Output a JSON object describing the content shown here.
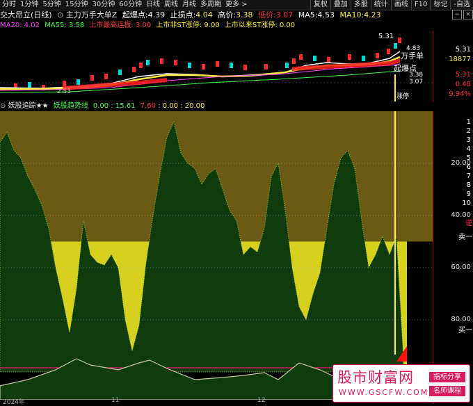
{
  "toolbar": {
    "periods": [
      "分时",
      "1分钟",
      "5分钟",
      "15分钟",
      "30分钟",
      "60分钟",
      "日线",
      "周线",
      "月线",
      "多周期",
      "更多 >"
    ],
    "right": [
      "复权",
      "叠加",
      "多股",
      "统计",
      "画线",
      "F10",
      "标记",
      "-自选"
    ]
  },
  "info1": {
    "stock": "交大昂立(日线)",
    "indicator": "主力万手大单Z",
    "stop_label": "起爆点:",
    "stop_val": "4.39",
    "sl_label": "止损点:",
    "sl_val": "4.04",
    "high_label": "高价:",
    "high_val": "3.38",
    "low_label": "低价:",
    "low_val": "3.07",
    "ma5_label": "MA5:",
    "ma5_val": "4.53",
    "ma10_label": "MA10:",
    "ma10_val": "4.23"
  },
  "info2": {
    "ma20": "MA20: 4.02",
    "ma55": "MA55: 3.58",
    "t1": "上市最高连板: 3.00",
    "t2": "上市非ST涨停: 9.00",
    "t3": "上市以来ST涨停: 0.00"
  },
  "main_annotations": {
    "price_top": "5.31",
    "wansh": "万手单",
    "qibao": "起爆点",
    "p1": "4.83",
    "p2": "3.38",
    "p3": "3.07",
    "left": "2.53",
    "zhangting": "涨停"
  },
  "right_axis": {
    "top": [
      "5.31",
      "18877",
      "5.31",
      "0.48",
      "9.94%"
    ],
    "mid": "527",
    "nums": [
      "1",
      "2",
      "3",
      "4",
      "5",
      "6",
      "7",
      "8",
      "9",
      "10"
    ],
    "labels": {
      "ticks": [
        "80.00",
        "60.00",
        "40.00",
        "20.00"
      ],
      "sell": "卖一",
      "buy": "买一",
      "ni": "逆"
    }
  },
  "ind_header": {
    "name": "妖股追踪★★",
    "line": "妖股趋势线",
    "v1": "0.00",
    "v2": "15.61",
    "v3": "7.60",
    "v4": "0.00",
    "v5": "20.00"
  },
  "xaxis": {
    "labels": [
      "2024年",
      "11",
      "12"
    ]
  },
  "watermark": {
    "title": "股市财富网",
    "url": "WWW.GSCFW.COM",
    "tag1": "指标分享",
    "tag2": "名师课程"
  },
  "chart_data": {
    "type": "area",
    "title": "妖股追踪",
    "ylim": [
      0,
      100
    ],
    "yticks": [
      20,
      40,
      60,
      80
    ],
    "bands": {
      "upper_zone_from": 50,
      "lower_zone_to": 50
    },
    "series": [
      {
        "name": "妖股趋势线",
        "x": [
          0,
          10,
          20,
          30,
          40,
          50,
          60,
          70,
          80,
          90,
          100,
          110,
          120,
          130,
          140,
          150,
          160,
          170,
          180,
          190,
          200,
          210,
          220,
          230,
          240,
          250,
          260,
          270,
          280,
          290,
          300,
          310,
          320,
          330,
          340,
          350,
          360,
          370,
          380,
          390,
          400,
          410,
          420,
          430,
          440,
          450,
          460,
          470,
          480,
          490,
          500,
          510,
          520,
          530,
          540,
          550,
          560,
          570,
          580
        ],
        "values": [
          88,
          92,
          85,
          82,
          75,
          70,
          64,
          55,
          40,
          28,
          15,
          32,
          58,
          45,
          42,
          41,
          45,
          40,
          20,
          8,
          18,
          42,
          60,
          76,
          90,
          96,
          84,
          80,
          78,
          72,
          76,
          78,
          70,
          62,
          58,
          45,
          48,
          46,
          55,
          75,
          80,
          62,
          40,
          25,
          20,
          30,
          38,
          55,
          72,
          82,
          85,
          78,
          58,
          40,
          45,
          52,
          45,
          52,
          5
        ]
      }
    ]
  }
}
